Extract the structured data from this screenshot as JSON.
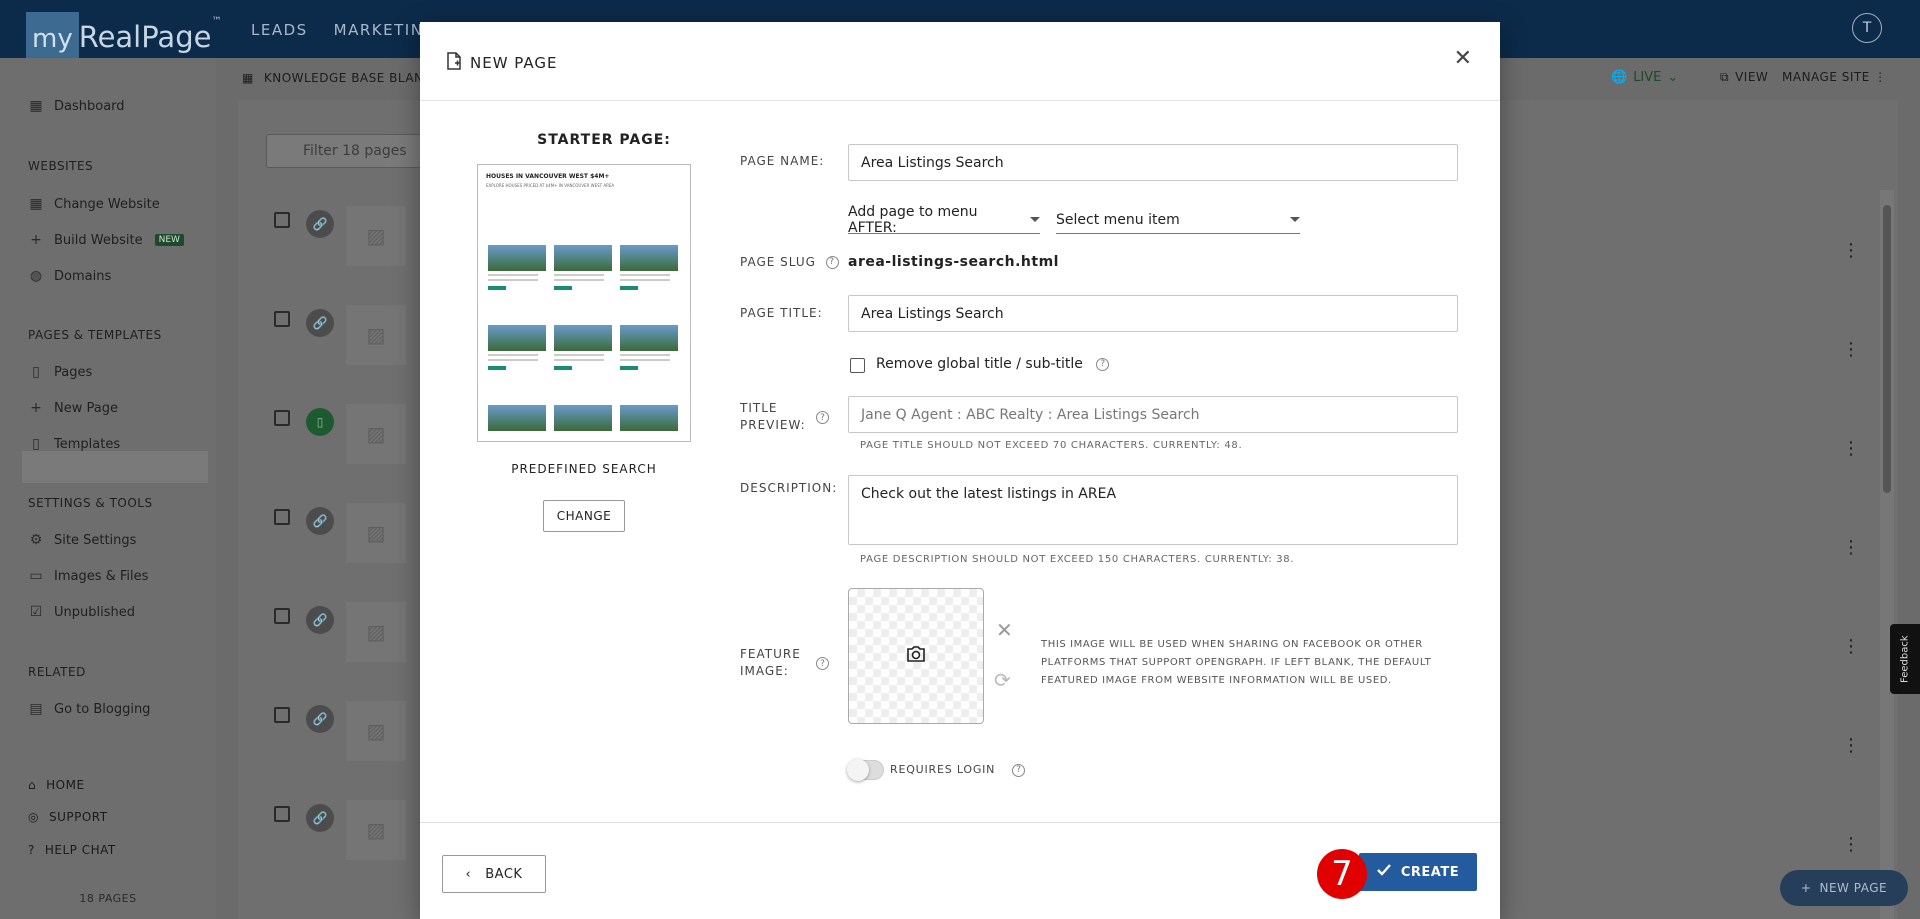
{
  "app": {
    "logo_my": "my",
    "logo_rest": "RealPage",
    "logo_tm": "™",
    "nav": [
      "LEADS",
      "MARKETIN"
    ],
    "avatar_initial": "T"
  },
  "subbar": {
    "title": "KNOWLEDGE BASE BLANK",
    "live_label": "LIVE",
    "view_label": "VIEW",
    "manage_label": "MANAGE SITE"
  },
  "sidebar": {
    "dashboard": "Dashboard",
    "websites_head": "WEBSITES",
    "change_website": "Change Website",
    "build_website": "Build Website",
    "build_badge": "NEW",
    "domains": "Domains",
    "pages_head": "PAGES & TEMPLATES",
    "pages": "Pages",
    "new_page": "New Page",
    "templates": "Templates",
    "settings_head": "SETTINGS & TOOLS",
    "site_settings": "Site Settings",
    "images_files": "Images & Files",
    "unpublished": "Unpublished",
    "related_head": "RELATED",
    "go_blogging": "Go to Blogging",
    "home": "HOME",
    "support": "SUPPORT",
    "help_chat": "HELP CHAT",
    "pages_count": "18 PAGES"
  },
  "content": {
    "filter_placeholder": "Filter 18 pages",
    "feedback": "Feedback",
    "new_page_fab": "NEW PAGE"
  },
  "modal": {
    "title": "NEW PAGE",
    "starter_label": "STARTER PAGE:",
    "thumb_title": "HOUSES IN VANCOUVER WEST $4M+",
    "thumb_sub": "EXPLORE HOUSES PRICED AT $4M+ IN VANCOUVER WEST AREA",
    "starter_name": "PREDEFINED SEARCH",
    "change_label": "CHANGE",
    "page_name_label": "PAGE NAME:",
    "page_name_value": "Area Listings Search",
    "menu_after_label": "Add page to menu AFTER:",
    "menu_item_placeholder": "Select menu item",
    "slug_label": "PAGE SLUG",
    "slug_value": "area-listings-search.html",
    "page_title_label": "PAGE TITLE:",
    "page_title_value": "Area Listings Search",
    "remove_global_label": "Remove global title / sub-title",
    "title_preview_label_1": "TITLE",
    "title_preview_label_2": "PREVIEW:",
    "title_preview_value": "Jane Q Agent : ABC Realty : Area Listings Search",
    "title_hint": "PAGE TITLE SHOULD NOT EXCEED 70 CHARACTERS. CURRENTLY: 48.",
    "description_label": "DESCRIPTION:",
    "description_value": "Check out the latest listings in AREA",
    "description_hint": "PAGE DESCRIPTION SHOULD NOT EXCEED 150 CHARACTERS. CURRENTLY: 38.",
    "feature_label_1": "FEATURE",
    "feature_label_2": "IMAGE:",
    "feature_note": "THIS IMAGE WILL BE USED WHEN SHARING ON FACEBOOK OR OTHER PLATFORMS THAT SUPPORT OPENGRAPH. IF LEFT BLANK, THE DEFAULT FEATURED IMAGE FROM WEBSITE INFORMATION WILL BE USED.",
    "requires_login_label": "REQUIRES LOGIN",
    "back_label": "BACK",
    "create_label": "CREATE",
    "step_number": "7"
  },
  "colors": {
    "primary_button": "#245a9e",
    "step_badge": "#e00000",
    "topbar": "#0c2a4a"
  }
}
